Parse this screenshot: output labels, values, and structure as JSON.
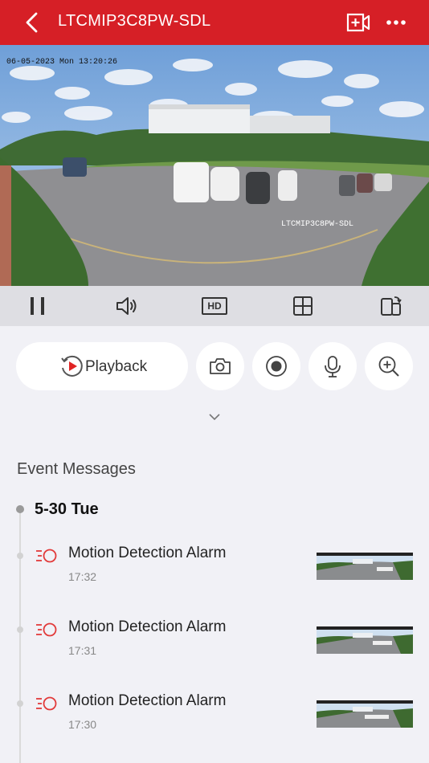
{
  "header": {
    "title": "LTCMIP3C8PW-SDL",
    "back_icon": "chevron-left-icon",
    "record_icon": "video-add-icon",
    "more_icon": "more-icon",
    "color": "#d61f26"
  },
  "video": {
    "osd_timestamp": "06-05-2023 Mon 13:20:26",
    "osd_camera_name": "LTCMIP3C8PW-SDL"
  },
  "toolbar": {
    "items": [
      {
        "name": "pause",
        "icon": "pause-icon"
      },
      {
        "name": "audio",
        "icon": "speaker-icon"
      },
      {
        "name": "quality",
        "label": "HD"
      },
      {
        "name": "layout",
        "icon": "grid-icon"
      },
      {
        "name": "rotate",
        "icon": "rotate-device-icon"
      }
    ]
  },
  "actions": {
    "playback_label": "Playback",
    "buttons": [
      "camera-icon",
      "record-icon",
      "microphone-icon",
      "zoom-in-icon"
    ]
  },
  "events": {
    "title": "Event Messages",
    "date": "5-30 Tue",
    "items": [
      {
        "name": "Motion Detection Alarm",
        "time": "17:32"
      },
      {
        "name": "Motion Detection Alarm",
        "time": "17:31"
      },
      {
        "name": "Motion Detection Alarm",
        "time": "17:30"
      }
    ]
  }
}
